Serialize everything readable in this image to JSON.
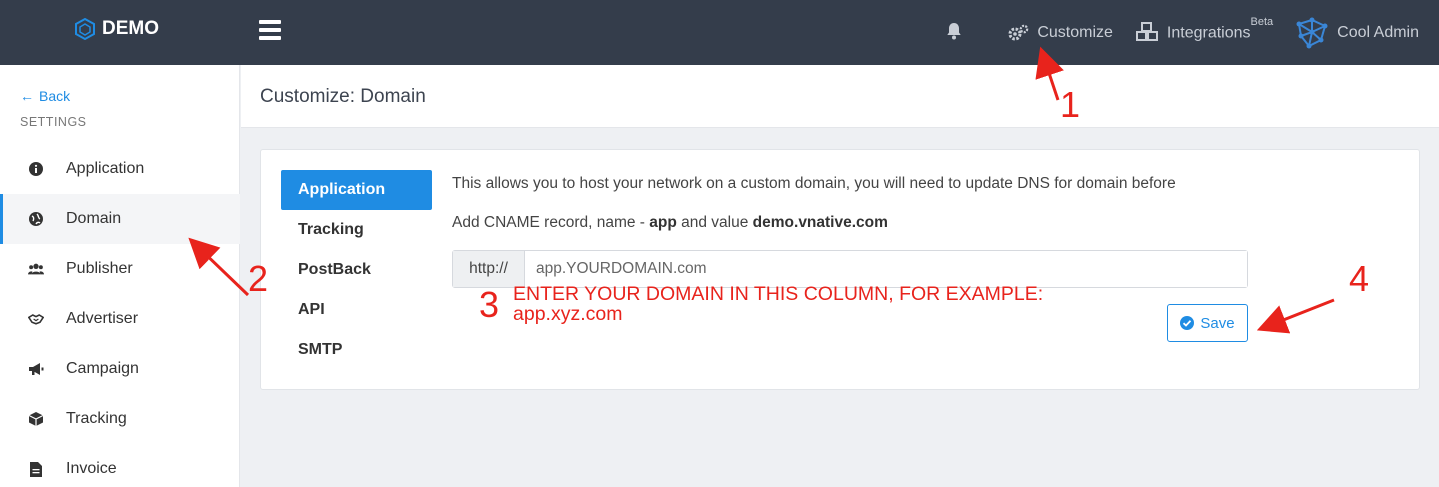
{
  "topbar": {
    "brand": "DEMO",
    "customize_label": "Customize",
    "integrations_label": "Integrations",
    "integrations_badge": "Beta",
    "user_name": "Cool Admin"
  },
  "sidebar": {
    "back_label": "Back",
    "section_label": "SETTINGS",
    "items": [
      {
        "label": "Application",
        "icon": "info-circle-icon"
      },
      {
        "label": "Domain",
        "icon": "globe-icon",
        "active": true
      },
      {
        "label": "Publisher",
        "icon": "users-icon"
      },
      {
        "label": "Advertiser",
        "icon": "handshake-icon"
      },
      {
        "label": "Campaign",
        "icon": "megaphone-icon"
      },
      {
        "label": "Tracking",
        "icon": "cube-icon"
      },
      {
        "label": "Invoice",
        "icon": "file-icon"
      }
    ]
  },
  "page": {
    "title": "Customize: Domain"
  },
  "tabs": [
    "Application",
    "Tracking",
    "PostBack",
    "API",
    "SMTP"
  ],
  "content": {
    "description": "This allows you to host your network on a custom domain, you will need to update DNS for domain before",
    "cname_prefix": "Add CNAME record, name - ",
    "cname_name": "app",
    "cname_middle": " and value ",
    "cname_value": "demo.vnative.com",
    "input_addon": "http://",
    "input_placeholder": "app.YOURDOMAIN.com",
    "save_label": "Save"
  },
  "annotations": {
    "step1": "1",
    "step2": "2",
    "step3": "3",
    "step4": "4",
    "note_line1": "ENTER YOUR DOMAIN IN THIS COLUMN, FOR EXAMPLE:",
    "note_line2": "app.xyz.com"
  },
  "colors": {
    "topbar": "#343d4b",
    "accent": "#1f8ce3",
    "annotation": "#e8231c"
  }
}
